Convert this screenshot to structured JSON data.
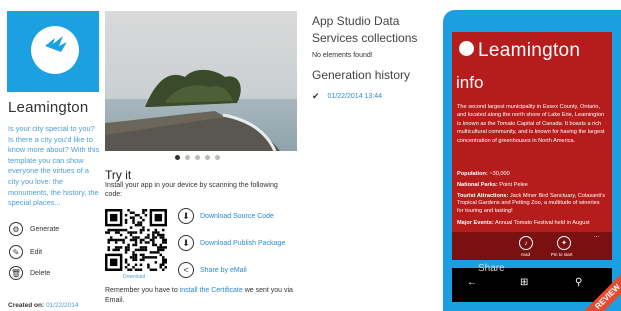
{
  "app": {
    "name": "Leamington",
    "description": "Is your city special to you? Is there a city you'd like to know more about? With this template you can show everyone the virtues of a city you love: the monuments, the history, the special places...",
    "actions": [
      {
        "label": "Generate",
        "icon": "gear-icon"
      },
      {
        "label": "Edit",
        "icon": "pencil-icon"
      },
      {
        "label": "Delete",
        "icon": "trash-icon"
      }
    ],
    "created_label": "Created on:",
    "created_date": "01/22/2014",
    "tile_color": "#1ba1e2"
  },
  "carousel": {
    "dots": 5,
    "active": 0
  },
  "try_it": {
    "title": "Try it",
    "text": "Install your app in your device by scanning the following code:",
    "qr_caption": "Download",
    "links": [
      {
        "label": "Download Source Code",
        "icon": "download-icon"
      },
      {
        "label": "Download Publish Package",
        "icon": "download-icon"
      },
      {
        "label": "Share by eMail",
        "icon": "share-icon"
      }
    ],
    "remember_prefix": "Remember you have to",
    "remember_link": "install the Certificate",
    "remember_suffix": "we sent you via Email."
  },
  "data_services": {
    "title": "App Studio Data Services collections",
    "empty_text": "No elements found!"
  },
  "generation_history": {
    "title": "Generation history",
    "entries": [
      {
        "date": "01/22/2014 13:44"
      }
    ]
  },
  "phone": {
    "title": "Leamington",
    "heading": "info",
    "intro": "The second largest municipality in Essex County, Ontario, and located along the north shore of Lake Erie, Leamington is known as the Tomato Capital of Canada. It boasts a rich multicultural community, and is known for having the largest concentration of greenhouses in North America.",
    "facts": [
      {
        "label": "Population:",
        "value": "~30,000"
      },
      {
        "label": "National Parks:",
        "value": "Point Pelee"
      },
      {
        "label": "Tourist Attractions:",
        "value": "Jack Miner Bird Sanctuary, Colasanti's Tropical Gardens and Petting Zoo, a multitude of wineries for touring and tasting!"
      },
      {
        "label": "Major Events:",
        "value": "Annual Tomato Festival held in August"
      }
    ],
    "appbar": [
      {
        "label": "read",
        "icon": "speaker-icon"
      },
      {
        "label": "Pin to start",
        "icon": "pin-icon"
      }
    ],
    "more": "...",
    "share": "Share",
    "ribbon": "REVIEW",
    "screen_color": "#b71c1c",
    "body_color": "#1a9fe0"
  }
}
